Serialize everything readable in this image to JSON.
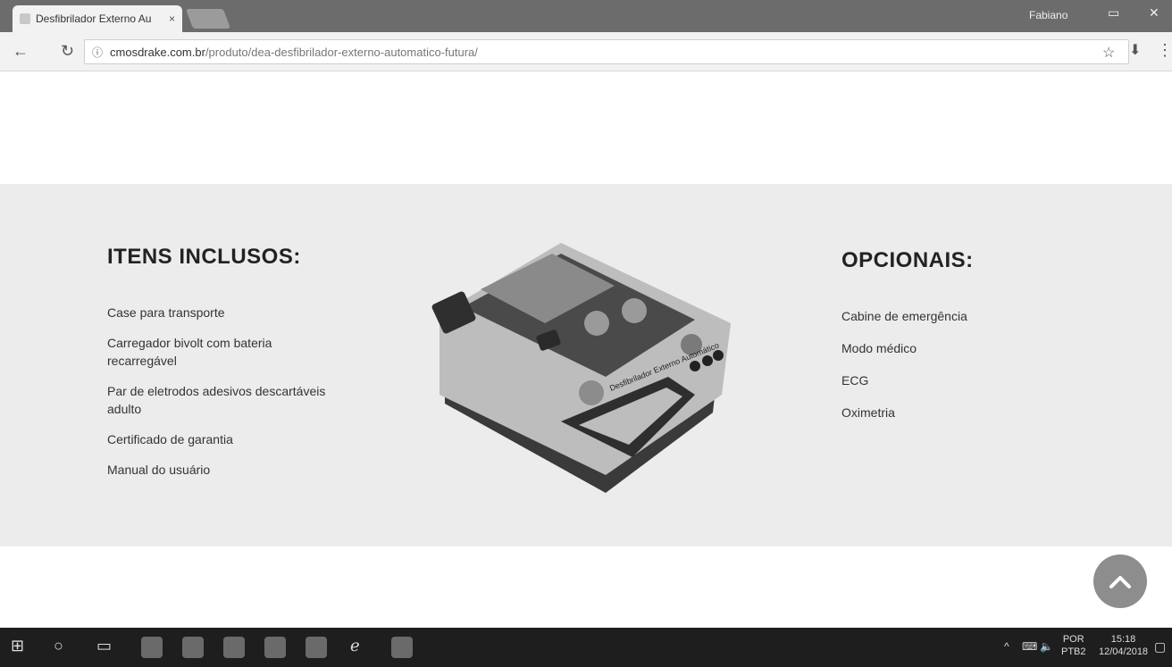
{
  "browser": {
    "tab_title": "Desfibrilador Externo Au",
    "tab_close": "×",
    "user_name": "Fabiano",
    "url_host": "cmosdrake.com.br",
    "url_path": "/produto/dea-desfibrilador-externo-automatico-futura/"
  },
  "page": {
    "included_title": "ITENS INCLUSOS:",
    "included_items": [
      "Case para transporte",
      "Carregador bivolt com bateria recarregável",
      "Par de eletrodos adesivos descartáveis adulto",
      "Certificado de garantia",
      "Manual do usuário"
    ],
    "optional_title": "OPCIONAIS:",
    "optional_items": [
      "Cabine de emergência",
      "Modo médico",
      "ECG",
      "Oximetria"
    ],
    "device_label": "Desfibrilador Externo Automático"
  },
  "taskbar": {
    "lang_top": "POR",
    "lang_bottom": "PTB2",
    "time": "15:18",
    "date": "12/04/2018"
  },
  "icons": {
    "back": "arrow-left",
    "reload": "reload",
    "info": "info",
    "star": "star",
    "download": "download",
    "scroll_top": "chevron-up"
  }
}
